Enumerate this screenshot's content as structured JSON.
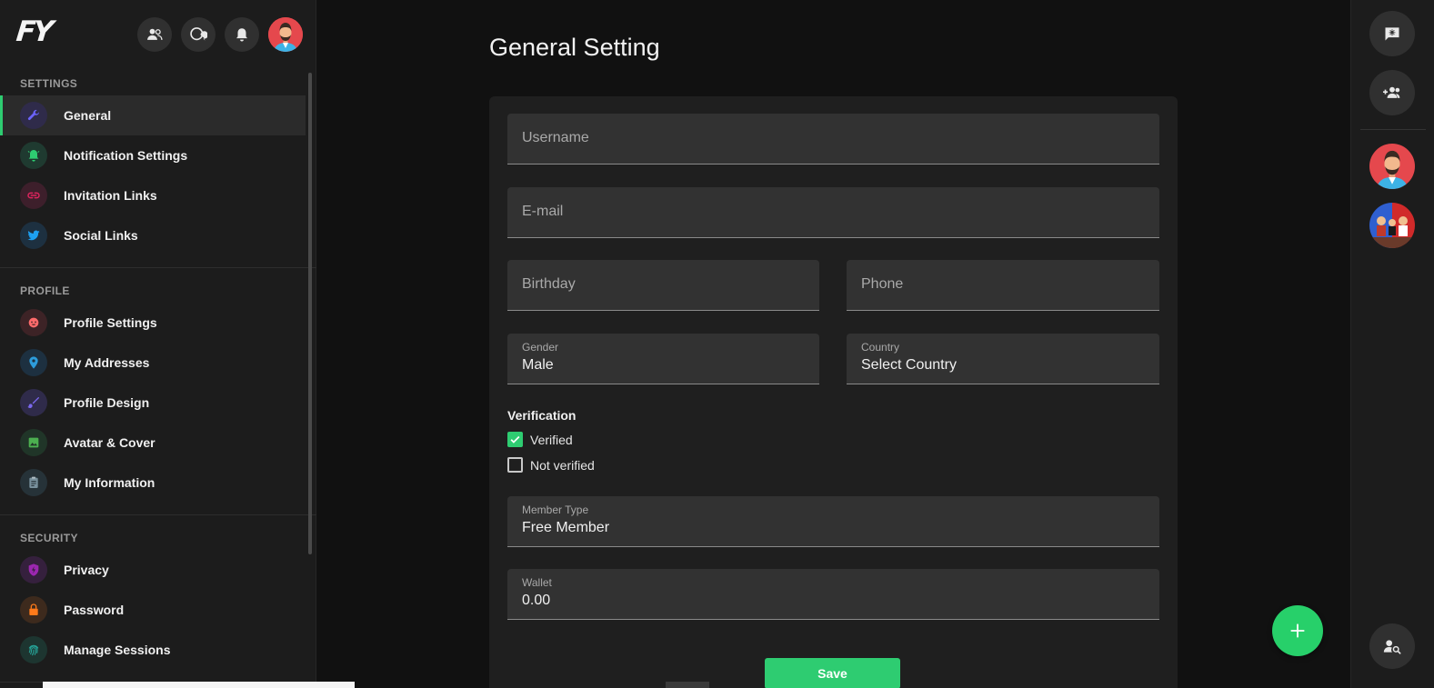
{
  "brand": {
    "logo_text": "FY"
  },
  "header_icons": [
    "friends-icon",
    "messages-icon",
    "bell-icon",
    "avatar"
  ],
  "sidebar": {
    "sections": [
      {
        "title": "SETTINGS",
        "items": [
          {
            "label": "General",
            "icon": "wrench-icon",
            "active": true
          },
          {
            "label": "Notification Settings",
            "icon": "bell-icon"
          },
          {
            "label": "Invitation Links",
            "icon": "link-icon"
          },
          {
            "label": "Social Links",
            "icon": "twitter-icon"
          }
        ]
      },
      {
        "title": "PROFILE",
        "items": [
          {
            "label": "Profile Settings",
            "icon": "face-icon"
          },
          {
            "label": "My Addresses",
            "icon": "location-pin-icon"
          },
          {
            "label": "Profile Design",
            "icon": "brush-icon"
          },
          {
            "label": "Avatar & Cover",
            "icon": "image-icon"
          },
          {
            "label": "My Information",
            "icon": "clipboard-icon"
          }
        ]
      },
      {
        "title": "SECURITY",
        "items": [
          {
            "label": "Privacy",
            "icon": "shield-icon"
          },
          {
            "label": "Password",
            "icon": "lock-icon"
          },
          {
            "label": "Manage Sessions",
            "icon": "fingerprint-icon"
          }
        ]
      }
    ]
  },
  "main": {
    "title": "General Setting",
    "form": {
      "username": {
        "placeholder": "Username"
      },
      "email": {
        "placeholder": "E-mail"
      },
      "birthday": {
        "placeholder": "Birthday"
      },
      "phone": {
        "placeholder": "Phone"
      },
      "gender": {
        "label": "Gender",
        "value": "Male"
      },
      "country": {
        "label": "Country",
        "value": "Select Country"
      },
      "verification": {
        "title": "Verification",
        "options": [
          {
            "label": "Verified",
            "checked": true
          },
          {
            "label": "Not verified",
            "checked": false
          }
        ]
      },
      "member_type": {
        "label": "Member Type",
        "value": "Free Member"
      },
      "wallet": {
        "label": "Wallet",
        "value": "0.00"
      },
      "save_label": "Save"
    },
    "fab_icon": "plus-icon"
  },
  "right_rail": {
    "buttons": [
      "chat-settings-icon",
      "add-user-icon"
    ],
    "avatars": [
      "user-avatar",
      "group-avatar"
    ],
    "bottom_button": "search-user-icon"
  },
  "colors": {
    "accent": "#2ecc71",
    "background": "#111111",
    "panel": "#1c1c1c",
    "field": "#323232"
  }
}
